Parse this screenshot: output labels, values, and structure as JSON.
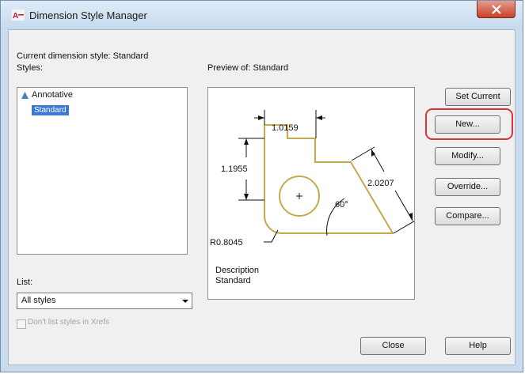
{
  "window": {
    "title": "Dimension Style Manager"
  },
  "current_style": {
    "text": "Current dimension style: Standard"
  },
  "styles": {
    "label": "Styles:",
    "items": [
      "Annotative",
      "Standard"
    ]
  },
  "preview": {
    "label": "Preview of: Standard",
    "dim_top": "1.0159",
    "dim_left": "1.1955",
    "dim_right": "2.0207",
    "angle": "60°",
    "radius": "R0.8045"
  },
  "buttons": {
    "set_current": "Set Current",
    "new": "New...",
    "modify": "Modify...",
    "override": "Override...",
    "compare": "Compare...",
    "close": "Close",
    "help": "Help"
  },
  "description": {
    "label": "Description",
    "value": "Standard"
  },
  "list": {
    "label": "List:",
    "selected": "All styles"
  },
  "dont_list": {
    "label": "Don't list styles in Xrefs",
    "checked": false
  },
  "colors": {
    "accent": "#3a7ad6",
    "focus": "#e0323a",
    "geometry": "#c8a84e"
  }
}
